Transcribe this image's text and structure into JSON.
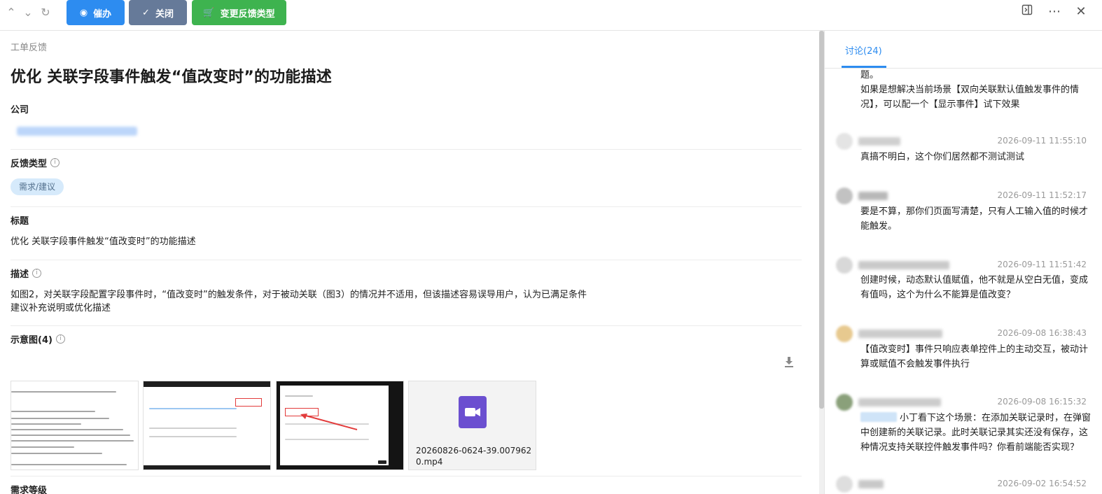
{
  "toolbar": {
    "urge_label": "催办",
    "close_label": "关闭",
    "change_type_label": "变更反馈类型"
  },
  "ticket": {
    "breadcrumb": "工单反馈",
    "title": "优化 关联字段事件触发“值改变时”的功能描述",
    "company_label": "公司",
    "feedback_type_label": "反馈类型",
    "feedback_type_value": "需求/建议",
    "subject_label": "标题",
    "subject_value": "优化 关联字段事件触发“值改变时”的功能描述",
    "description_label": "描述",
    "description_line1": "如图2，对关联字段配置字段事件时，“值改变时”的触发条件，对于被动关联（图3）的情况并不适用，但该描述容易误导用户，认为已满足条件",
    "description_line2": "建议补充说明或优化描述",
    "attachments_label": "示意图(4)",
    "video_filename": "20260826-0624-39.0079620.mp4",
    "priority_label": "需求等级"
  },
  "discussion": {
    "tab_label": "讨论(24)",
    "messages": [
      {
        "time": "",
        "text": "题。\n如果是想解决当前场景【双向关联默认值触发事件的情况】，可以配一个【显示事件】试下效果"
      },
      {
        "time": "2026-09-11 11:55:10",
        "text": "真搞不明白，这个你们居然都不测试测试"
      },
      {
        "time": "2026-09-11 11:52:17",
        "text": "要是不算，那你们页面写清楚，只有人工输入值的时候才能触发。"
      },
      {
        "time": "2026-09-11 11:51:42",
        "text": "创建时候，动态默认值赋值，他不就是从空白无值，变成有值吗，这个为什么不能算是值改变？"
      },
      {
        "time": "2026-09-08 16:38:43",
        "text": "【值改变时】事件只响应表单控件上的主动交互，被动计算或赋值不会触发事件执行"
      },
      {
        "time": "2026-09-08 16:15:32",
        "text": "小丁看下这个场景：在添加关联记录时，在弹窗中创建新的关联记录。此时关联记录其实还没有保存，这种情况支持关联控件触发事件吗？你看前端能否实现？"
      },
      {
        "time": "2026-09-02 16:54:52",
        "text": ""
      }
    ]
  }
}
